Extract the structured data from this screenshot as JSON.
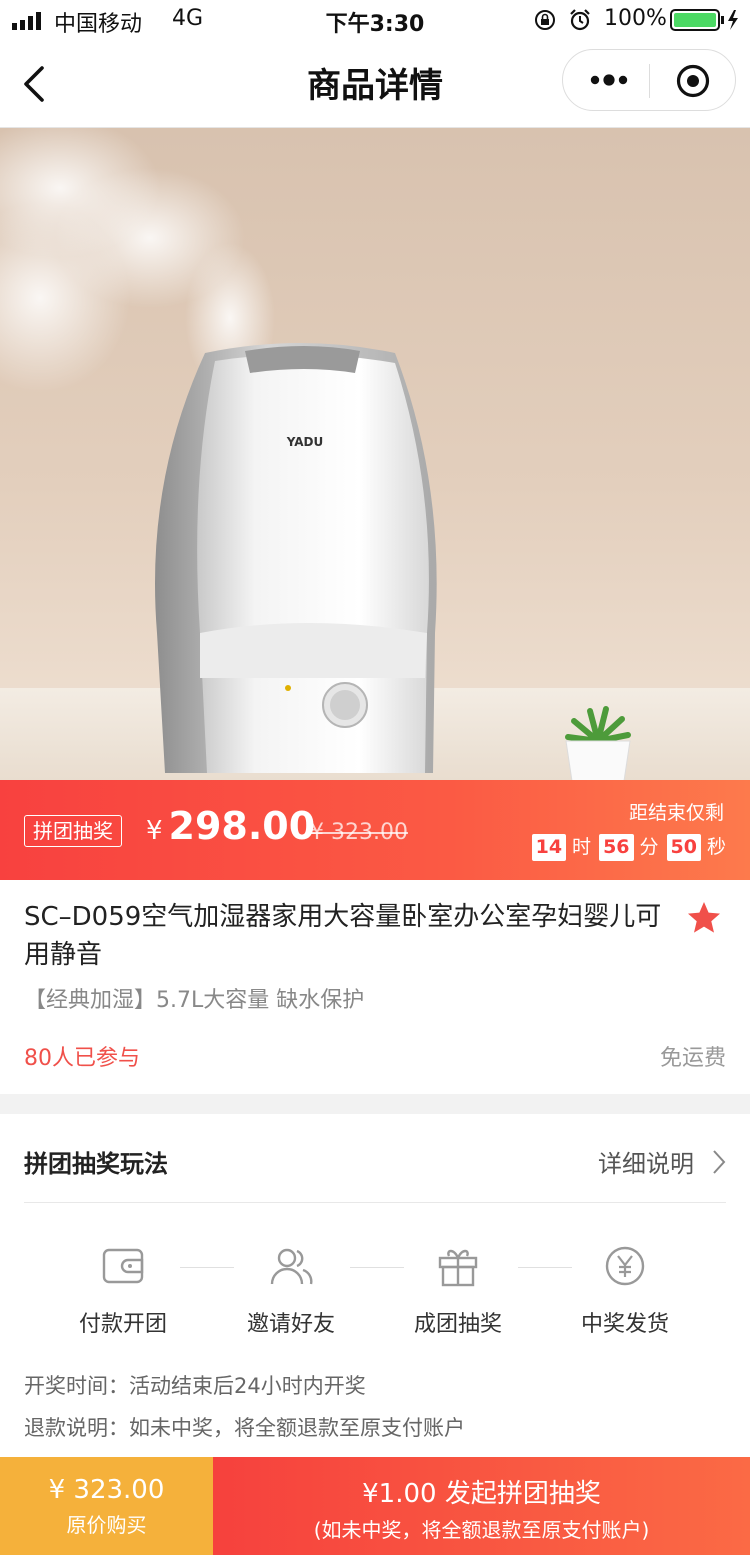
{
  "status_bar": {
    "carrier": "中国移动",
    "network": "4G",
    "time": "下午3:30",
    "battery": "100%"
  },
  "nav": {
    "title": "商品详情",
    "back_icon": "chevron-left-icon",
    "more_icon": "more-dots-icon",
    "close_icon": "target-close-icon"
  },
  "hero": {
    "brand_on_product": "YADU"
  },
  "price_bar": {
    "tag": "拼团抽奖",
    "currency": "¥",
    "price": "298.00",
    "original_price": "¥ 323.00",
    "countdown_label": "距结束仅剩",
    "countdown": {
      "hours": "14",
      "hours_unit": "时",
      "minutes": "56",
      "minutes_unit": "分",
      "seconds": "50",
      "seconds_unit": "秒"
    }
  },
  "product": {
    "title": "SC–D059空气加湿器家用大容量卧室办公室孕妇婴儿可用静音",
    "subtitle": "【经典加湿】5.7L大容量 缺水保护",
    "participants": "80人已参与",
    "shipping": "免运费",
    "favorite_icon": "star-icon"
  },
  "rules": {
    "title": "拼团抽奖玩法",
    "more": "详细说明",
    "steps": [
      {
        "label": "付款开团",
        "icon": "wallet-icon"
      },
      {
        "label": "邀请好友",
        "icon": "users-icon"
      },
      {
        "label": "成团抽奖",
        "icon": "gift-icon"
      },
      {
        "label": "中奖发货",
        "icon": "yen-coin-icon"
      }
    ],
    "draw_time": "开奖时间：活动结束后24小时内开奖",
    "refund": "退款说明：如未中奖，将全额退款至原支付账户"
  },
  "bottom_bar": {
    "orig_price": "¥ 323.00",
    "orig_label": "原价购买",
    "group_price_line": "¥1.00 发起拼团抽奖",
    "group_note": "(如未中奖，将全额退款至原支付账户)"
  },
  "colors": {
    "accent_red": "#f8413f",
    "accent_orange": "#fd7a4c",
    "buy_yellow": "#f5b13b",
    "participants_red": "#f0504a"
  }
}
